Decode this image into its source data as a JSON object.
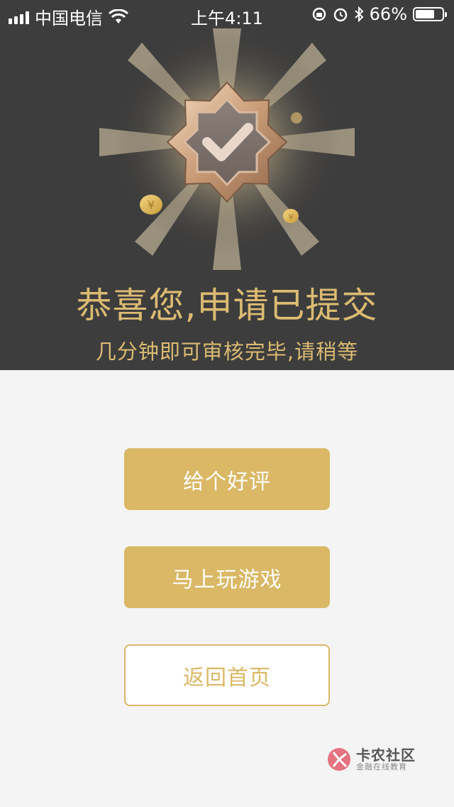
{
  "status_bar": {
    "carrier": "中国电信",
    "time": "上午4:11",
    "battery_percent": "66%",
    "battery_level": 0.66,
    "icons": [
      "signal-icon",
      "wifi-icon",
      "rotation-lock-icon",
      "alarm-icon",
      "bluetooth-icon",
      "battery-icon"
    ]
  },
  "hero": {
    "badge_icon": "checkmark-badge-icon",
    "coin_icon": "yen-coin-icon",
    "title": "恭喜您,申请已提交",
    "subtitle": "几分钟即可审核完毕,请稍等"
  },
  "actions": {
    "rate": "给个好评",
    "play_game": "马上玩游戏",
    "back_home": "返回首页"
  },
  "watermark": {
    "name": "卡农社区",
    "tagline": "金融在线教育"
  },
  "colors": {
    "header_bg": "#3d3d3d",
    "accent_gold": "#dab865",
    "title_gold": "#dcbb72",
    "page_bg": "#f4f4f4"
  }
}
